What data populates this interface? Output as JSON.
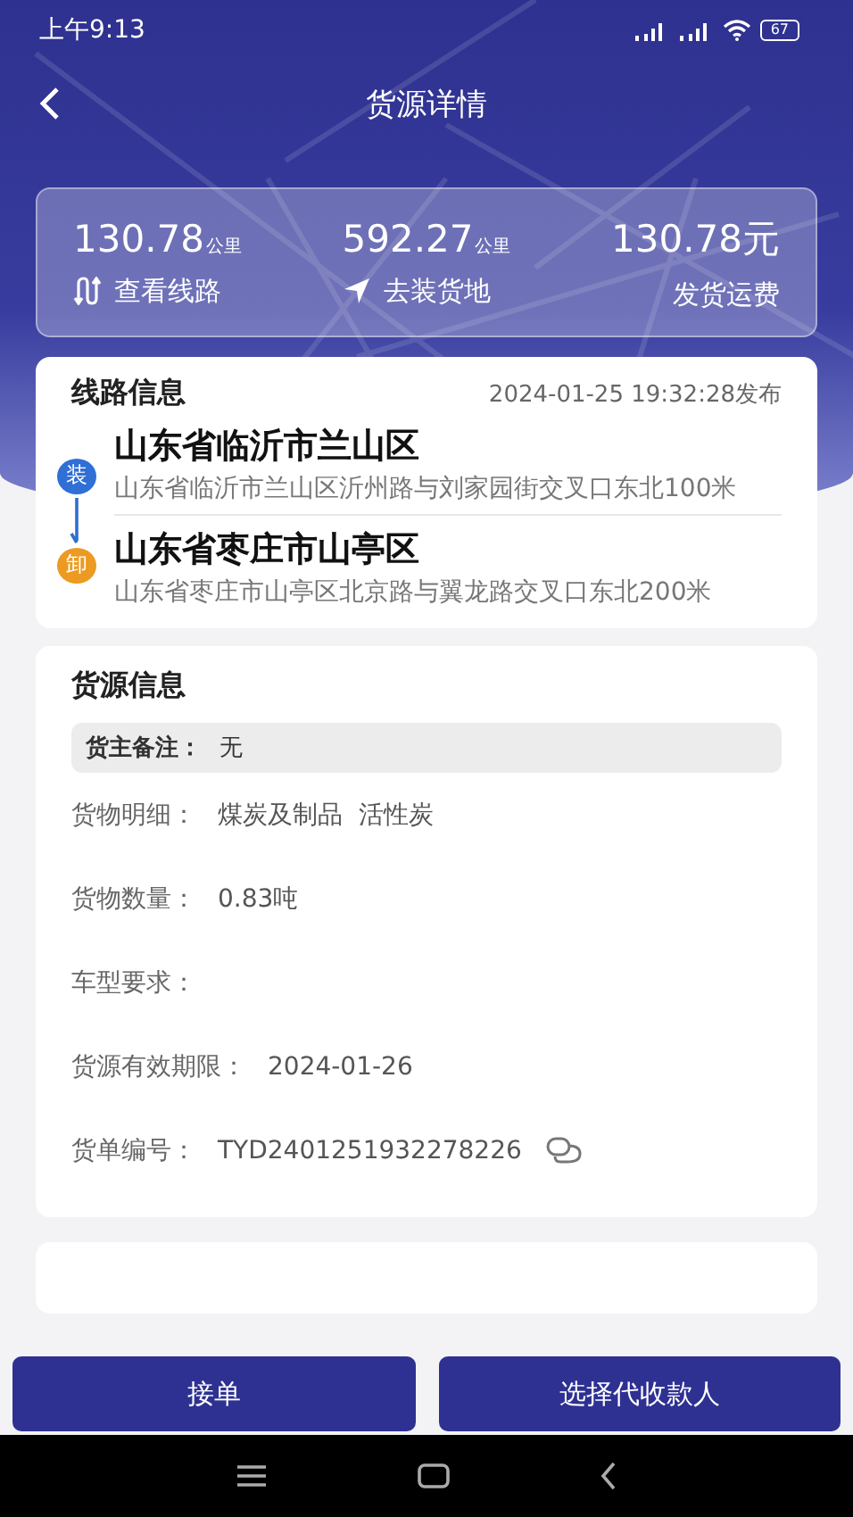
{
  "status_bar": {
    "time": "上午9:13",
    "battery": "67"
  },
  "header": {
    "title": "货源详情"
  },
  "summary": [
    {
      "kind": "route",
      "value": "130.78",
      "unit": "公里",
      "label": "查看线路"
    },
    {
      "kind": "navigate",
      "value": "592.27",
      "unit": "公里",
      "label": "去装货地"
    },
    {
      "kind": "plain",
      "value": "130.78元",
      "label": "发货运费"
    }
  ],
  "route_info": {
    "title": "线路信息",
    "published": "2024-01-25 19:32:28发布",
    "stops": [
      {
        "kind": "load",
        "badge": "装",
        "city": "山东省临沂市兰山区",
        "address": "山东省临沂市兰山区沂州路与刘家园街交叉口东北100米"
      },
      {
        "kind": "unload",
        "badge": "卸",
        "city": "山东省枣庄市山亭区",
        "address": "山东省枣庄市山亭区北京路与翼龙路交叉口东北200米"
      }
    ]
  },
  "cargo_info": {
    "title": "货源信息",
    "note": {
      "label": "货主备注：",
      "value": "无"
    },
    "fields": [
      {
        "kind": "text",
        "label": "货物明细：",
        "value": "煤炭及制品  活性炭"
      },
      {
        "kind": "text",
        "label": "货物数量：",
        "value": "0.83吨"
      },
      {
        "kind": "text",
        "label": "车型要求："
      },
      {
        "kind": "text",
        "label": "货源有效期限：",
        "value": "2024-01-26"
      },
      {
        "kind": "copy",
        "label": "货单编号：",
        "value": "TYD2401251932278226"
      }
    ]
  },
  "buttons": [
    "接单",
    "选择代收款人"
  ]
}
